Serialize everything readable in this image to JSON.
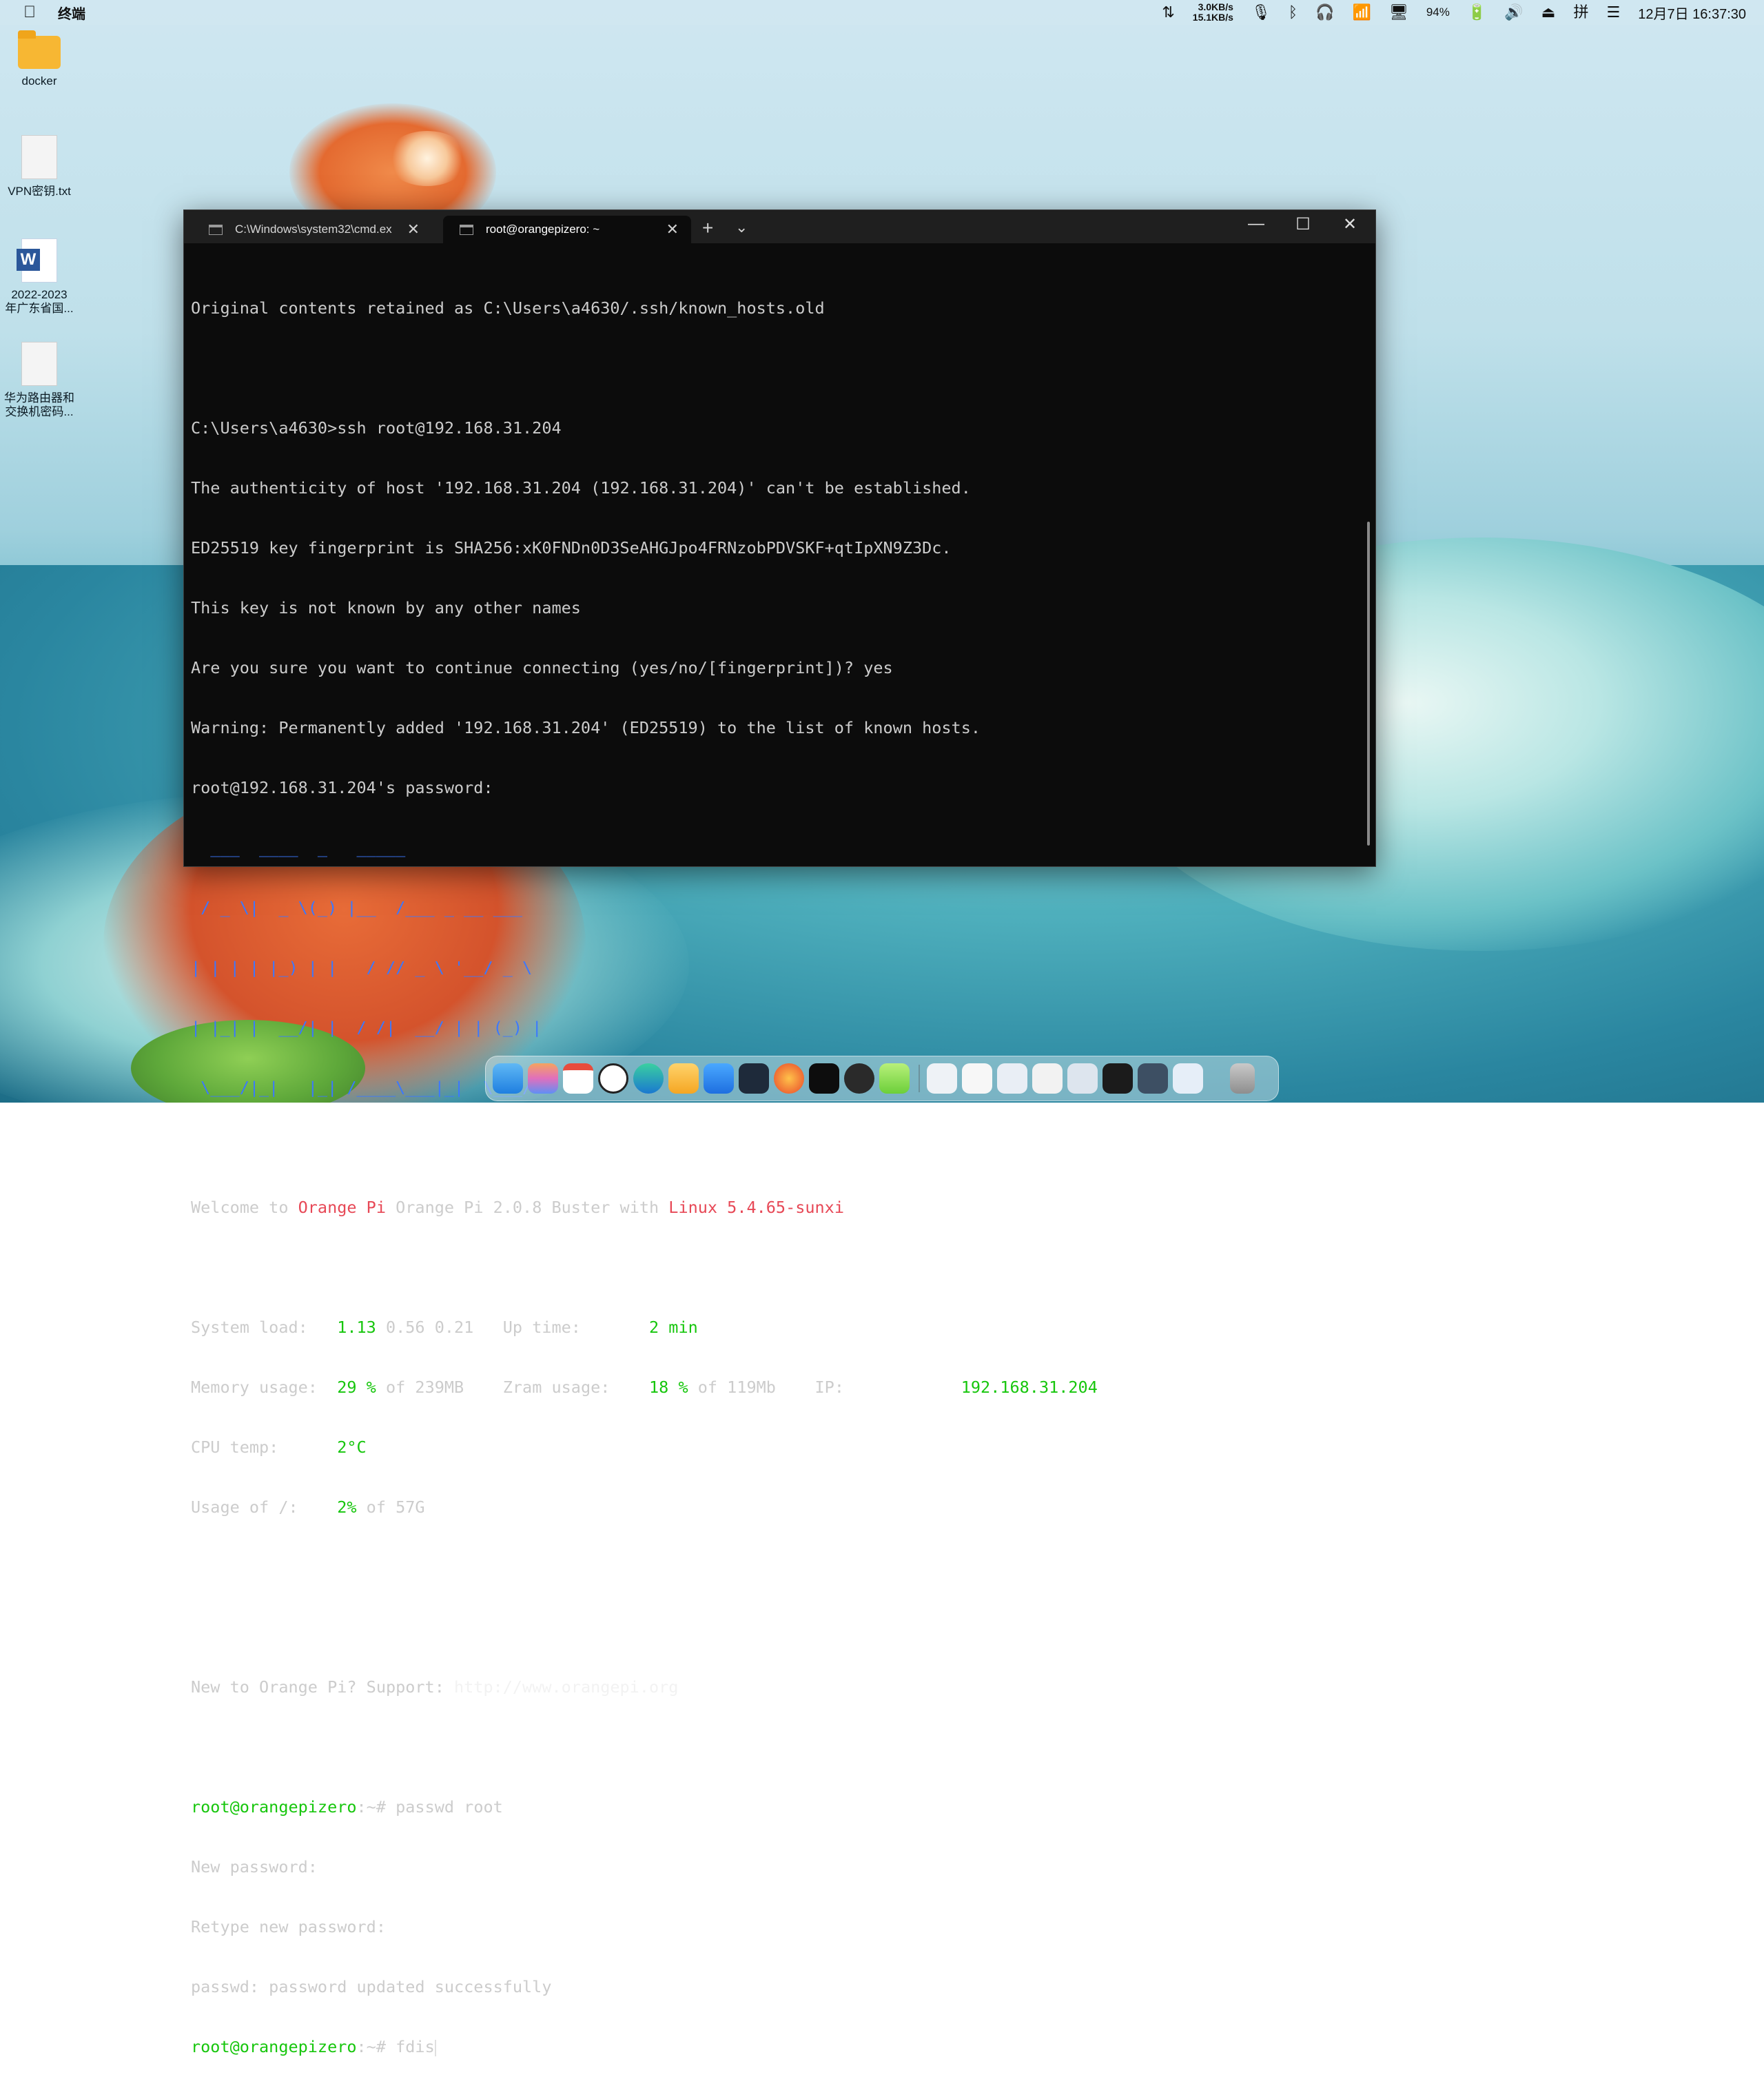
{
  "menubar": {
    "apple_icon": "",
    "app_name": "终端",
    "net_up": "3.0KB/s",
    "net_down": "15.1KB/s",
    "battery": "94%",
    "clock": "12月7日 16:37:30"
  },
  "desktop": {
    "icons": [
      {
        "label": "docker"
      },
      {
        "label": "VPN密钥.txt"
      },
      {
        "label1": "2022-2023",
        "label2": "年广东省国..."
      },
      {
        "label1": "华为路由器和",
        "label2": "交换机密码..."
      }
    ]
  },
  "terminal": {
    "tabs": [
      {
        "label": "C:\\Windows\\system32\\cmd.ex"
      },
      {
        "label": "root@orangepizero: ~"
      }
    ],
    "new_tab": "+",
    "dropdown": "⌄",
    "lines": {
      "l1": "Original contents retained as C:\\Users\\a4630/.ssh/known_hosts.old",
      "l2": "C:\\Users\\a4630>ssh root@192.168.31.204",
      "l3": "The authenticity of host '192.168.31.204 (192.168.31.204)' can't be established.",
      "l4": "ED25519 key fingerprint is SHA256:xK0FNDn0D3SeAHGJpo4FRNzobPDVSKF+qtIpXN9Z3Dc.",
      "l5": "This key is not known by any other names",
      "l6": "Are you sure you want to continue connecting (yes/no/[fingerprint])? yes",
      "l7": "Warning: Permanently added '192.168.31.204' (ED25519) to the list of known hosts.",
      "l8": "root@192.168.31.204's password:",
      "banner1": "  ___  ____  _   _____",
      "banner2": " / _ \\|  _ \\(_) |__  /___ _ __ ___",
      "banner3": "| | | | |_) | |   / // _ \\ '__/ _ \\",
      "banner4": "| |_| |  __/| |  / /|  __/ | | (_) |",
      "banner5": " \\___/|_|   |_| /____\\___|_|  \\___/",
      "welcome_a": "Welcome to ",
      "welcome_b": "Orange Pi",
      "welcome_c": " Orange Pi 2.0.8 Buster with ",
      "welcome_d": "Linux 5.4.65-sunxi",
      "sysload_label": "System load:   ",
      "sysload_v1": "1.13",
      "sysload_rest": " 0.56 0.21   ",
      "uptime_label": "Up time:       ",
      "uptime_val": "2 min",
      "mem_label": "Memory usage:  ",
      "mem_val": "29 %",
      "mem_rest": " of 239MB    ",
      "zram_label": "Zram usage:    ",
      "zram_val": "18 %",
      "zram_rest": " of 119Mb    ",
      "ip_label": "IP:            ",
      "ip_val": "192.168.31.204",
      "cpu_label": "CPU temp:      ",
      "cpu_val": "2°C",
      "usage_label": "Usage of /:    ",
      "usage_val": "2%",
      "usage_rest": " of 57G",
      "support_a": "New to Orange Pi? Support: ",
      "support_b": "http://www.orangepi.org",
      "prompt": "root@orangepizero",
      "prompt_tail": ":~#",
      "cmd1": " passwd root",
      "pw1": "New password:",
      "pw2": "Retype new password:",
      "pw3": "passwd: password updated successfully",
      "cmd2": " fdis"
    }
  }
}
